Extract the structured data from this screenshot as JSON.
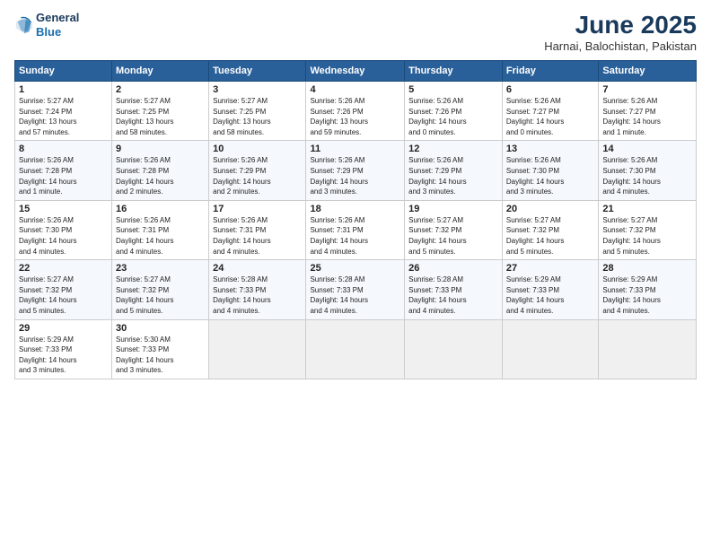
{
  "logo": {
    "general": "General",
    "blue": "Blue"
  },
  "title": "June 2025",
  "subtitle": "Harnai, Balochistan, Pakistan",
  "days_header": [
    "Sunday",
    "Monday",
    "Tuesday",
    "Wednesday",
    "Thursday",
    "Friday",
    "Saturday"
  ],
  "weeks": [
    [
      {
        "day": "1",
        "info": "Sunrise: 5:27 AM\nSunset: 7:24 PM\nDaylight: 13 hours\nand 57 minutes."
      },
      {
        "day": "2",
        "info": "Sunrise: 5:27 AM\nSunset: 7:25 PM\nDaylight: 13 hours\nand 58 minutes."
      },
      {
        "day": "3",
        "info": "Sunrise: 5:27 AM\nSunset: 7:25 PM\nDaylight: 13 hours\nand 58 minutes."
      },
      {
        "day": "4",
        "info": "Sunrise: 5:26 AM\nSunset: 7:26 PM\nDaylight: 13 hours\nand 59 minutes."
      },
      {
        "day": "5",
        "info": "Sunrise: 5:26 AM\nSunset: 7:26 PM\nDaylight: 14 hours\nand 0 minutes."
      },
      {
        "day": "6",
        "info": "Sunrise: 5:26 AM\nSunset: 7:27 PM\nDaylight: 14 hours\nand 0 minutes."
      },
      {
        "day": "7",
        "info": "Sunrise: 5:26 AM\nSunset: 7:27 PM\nDaylight: 14 hours\nand 1 minute."
      }
    ],
    [
      {
        "day": "8",
        "info": "Sunrise: 5:26 AM\nSunset: 7:28 PM\nDaylight: 14 hours\nand 1 minute."
      },
      {
        "day": "9",
        "info": "Sunrise: 5:26 AM\nSunset: 7:28 PM\nDaylight: 14 hours\nand 2 minutes."
      },
      {
        "day": "10",
        "info": "Sunrise: 5:26 AM\nSunset: 7:29 PM\nDaylight: 14 hours\nand 2 minutes."
      },
      {
        "day": "11",
        "info": "Sunrise: 5:26 AM\nSunset: 7:29 PM\nDaylight: 14 hours\nand 3 minutes."
      },
      {
        "day": "12",
        "info": "Sunrise: 5:26 AM\nSunset: 7:29 PM\nDaylight: 14 hours\nand 3 minutes."
      },
      {
        "day": "13",
        "info": "Sunrise: 5:26 AM\nSunset: 7:30 PM\nDaylight: 14 hours\nand 3 minutes."
      },
      {
        "day": "14",
        "info": "Sunrise: 5:26 AM\nSunset: 7:30 PM\nDaylight: 14 hours\nand 4 minutes."
      }
    ],
    [
      {
        "day": "15",
        "info": "Sunrise: 5:26 AM\nSunset: 7:30 PM\nDaylight: 14 hours\nand 4 minutes."
      },
      {
        "day": "16",
        "info": "Sunrise: 5:26 AM\nSunset: 7:31 PM\nDaylight: 14 hours\nand 4 minutes."
      },
      {
        "day": "17",
        "info": "Sunrise: 5:26 AM\nSunset: 7:31 PM\nDaylight: 14 hours\nand 4 minutes."
      },
      {
        "day": "18",
        "info": "Sunrise: 5:26 AM\nSunset: 7:31 PM\nDaylight: 14 hours\nand 4 minutes."
      },
      {
        "day": "19",
        "info": "Sunrise: 5:27 AM\nSunset: 7:32 PM\nDaylight: 14 hours\nand 5 minutes."
      },
      {
        "day": "20",
        "info": "Sunrise: 5:27 AM\nSunset: 7:32 PM\nDaylight: 14 hours\nand 5 minutes."
      },
      {
        "day": "21",
        "info": "Sunrise: 5:27 AM\nSunset: 7:32 PM\nDaylight: 14 hours\nand 5 minutes."
      }
    ],
    [
      {
        "day": "22",
        "info": "Sunrise: 5:27 AM\nSunset: 7:32 PM\nDaylight: 14 hours\nand 5 minutes."
      },
      {
        "day": "23",
        "info": "Sunrise: 5:27 AM\nSunset: 7:32 PM\nDaylight: 14 hours\nand 5 minutes."
      },
      {
        "day": "24",
        "info": "Sunrise: 5:28 AM\nSunset: 7:33 PM\nDaylight: 14 hours\nand 4 minutes."
      },
      {
        "day": "25",
        "info": "Sunrise: 5:28 AM\nSunset: 7:33 PM\nDaylight: 14 hours\nand 4 minutes."
      },
      {
        "day": "26",
        "info": "Sunrise: 5:28 AM\nSunset: 7:33 PM\nDaylight: 14 hours\nand 4 minutes."
      },
      {
        "day": "27",
        "info": "Sunrise: 5:29 AM\nSunset: 7:33 PM\nDaylight: 14 hours\nand 4 minutes."
      },
      {
        "day": "28",
        "info": "Sunrise: 5:29 AM\nSunset: 7:33 PM\nDaylight: 14 hours\nand 4 minutes."
      }
    ],
    [
      {
        "day": "29",
        "info": "Sunrise: 5:29 AM\nSunset: 7:33 PM\nDaylight: 14 hours\nand 3 minutes."
      },
      {
        "day": "30",
        "info": "Sunrise: 5:30 AM\nSunset: 7:33 PM\nDaylight: 14 hours\nand 3 minutes."
      },
      null,
      null,
      null,
      null,
      null
    ]
  ]
}
